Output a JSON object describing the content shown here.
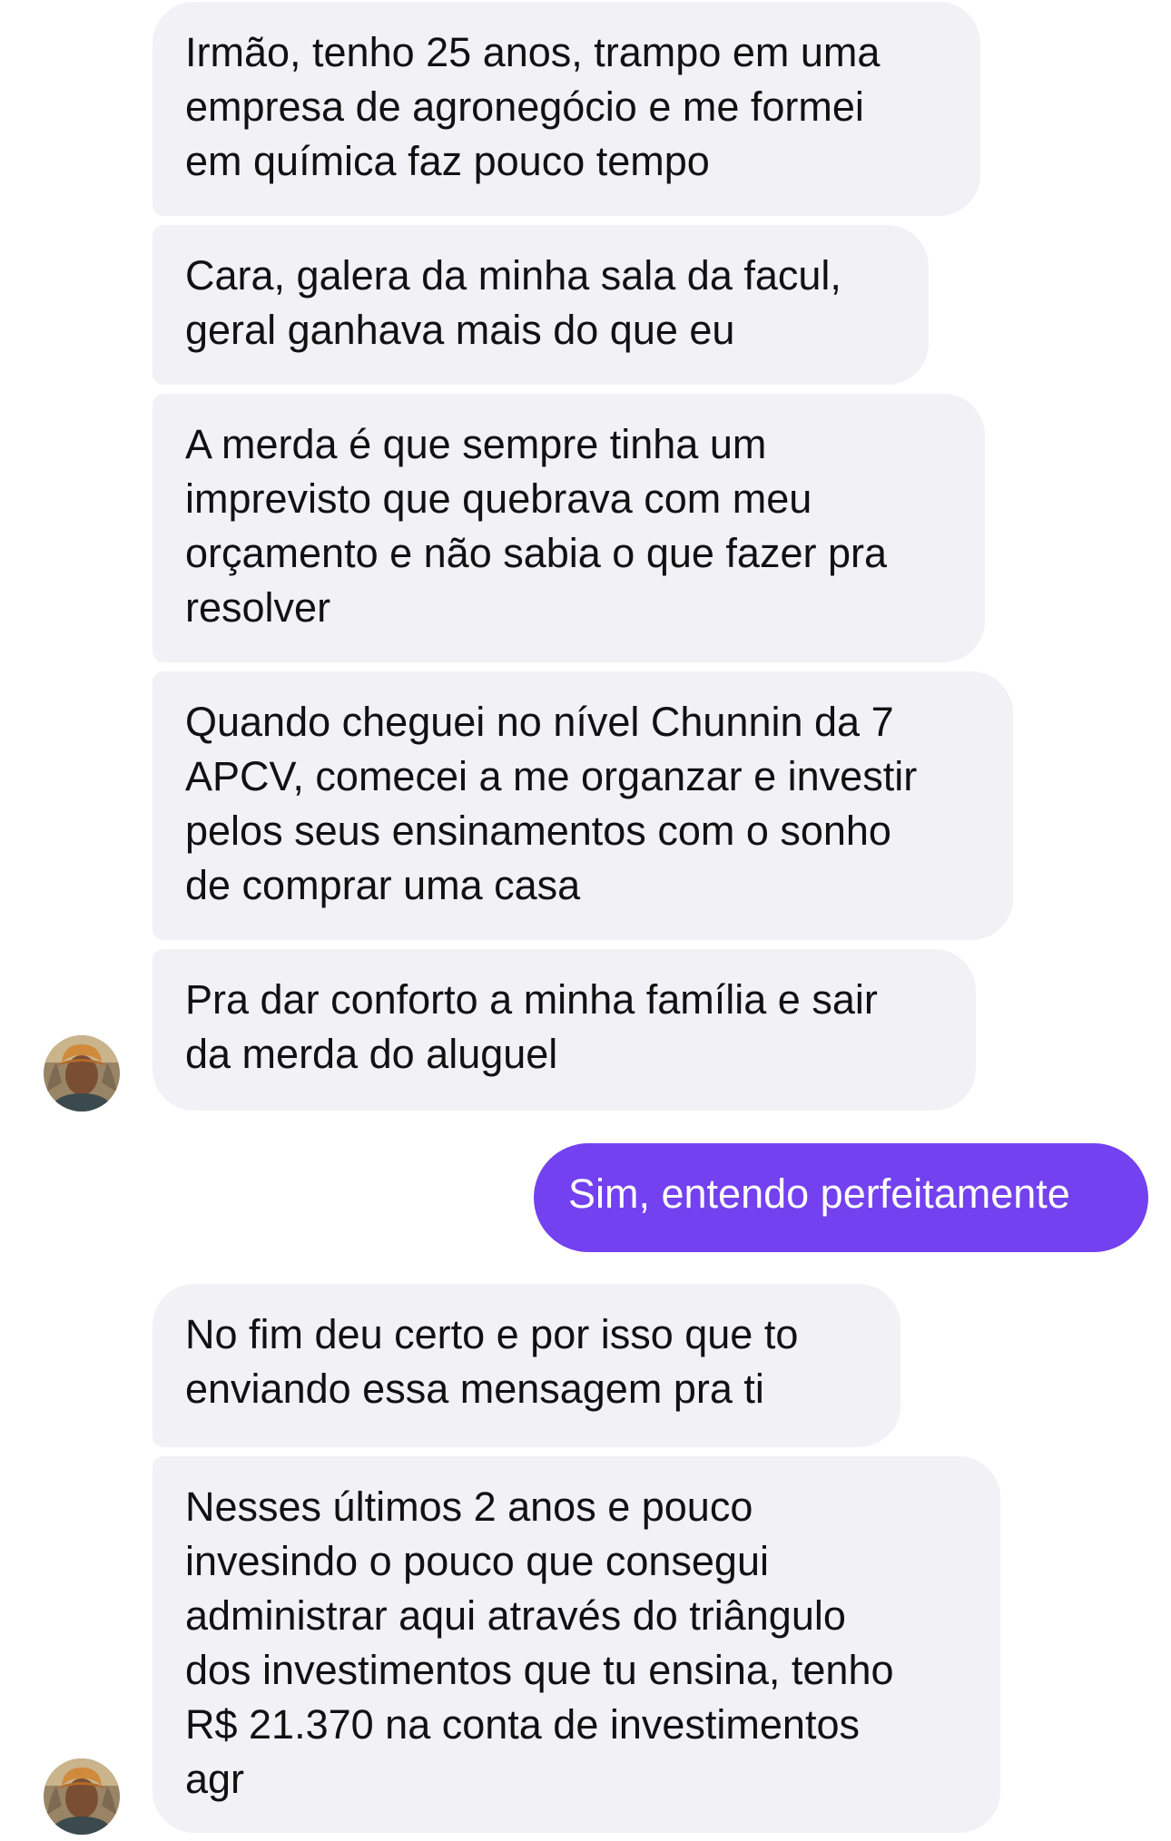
{
  "conversation": {
    "messages": [
      {
        "sender": "other",
        "text": "Irmão, tenho 25 anos, trampo em uma\nempresa de agronegócio e me formei\nem química faz pouco tempo"
      },
      {
        "sender": "other",
        "text": "Cara, galera da minha sala da facul,\ngeral ganhava mais do que eu"
      },
      {
        "sender": "other",
        "text": "A merda é que sempre tinha um\nimprevisto que quebrava com meu\norçamento e não sabia o que fazer pra\nresolver"
      },
      {
        "sender": "other",
        "text": "Quando cheguei no nível Chunnin da 7\nAPCV, comecei a me organzar e investir\npelos seus ensinamentos com o sonho\nde comprar uma casa"
      },
      {
        "sender": "other",
        "text": "Pra dar conforto a minha família e sair\nda merda do aluguel"
      },
      {
        "sender": "me",
        "text": "Sim, entendo perfeitamente"
      },
      {
        "sender": "other",
        "text": "No fim deu certo e por isso que to\nenviando essa mensagem pra ti"
      },
      {
        "sender": "other",
        "text": "Nesses últimos 2 anos e pouco\ninvesindo o pouco que consegui\nadministrar aqui através do triângulo\ndos investimentos que tu ensina, tenho\nR$ 21.370 na conta de investimentos\nagr"
      }
    ]
  },
  "colors": {
    "incoming_bubble": "#f1f1f6",
    "outgoing_bubble": "#7341f0",
    "incoming_text": "#111111",
    "outgoing_text": "#ffffff"
  },
  "icons": {
    "avatar": "contact-avatar-photo"
  }
}
